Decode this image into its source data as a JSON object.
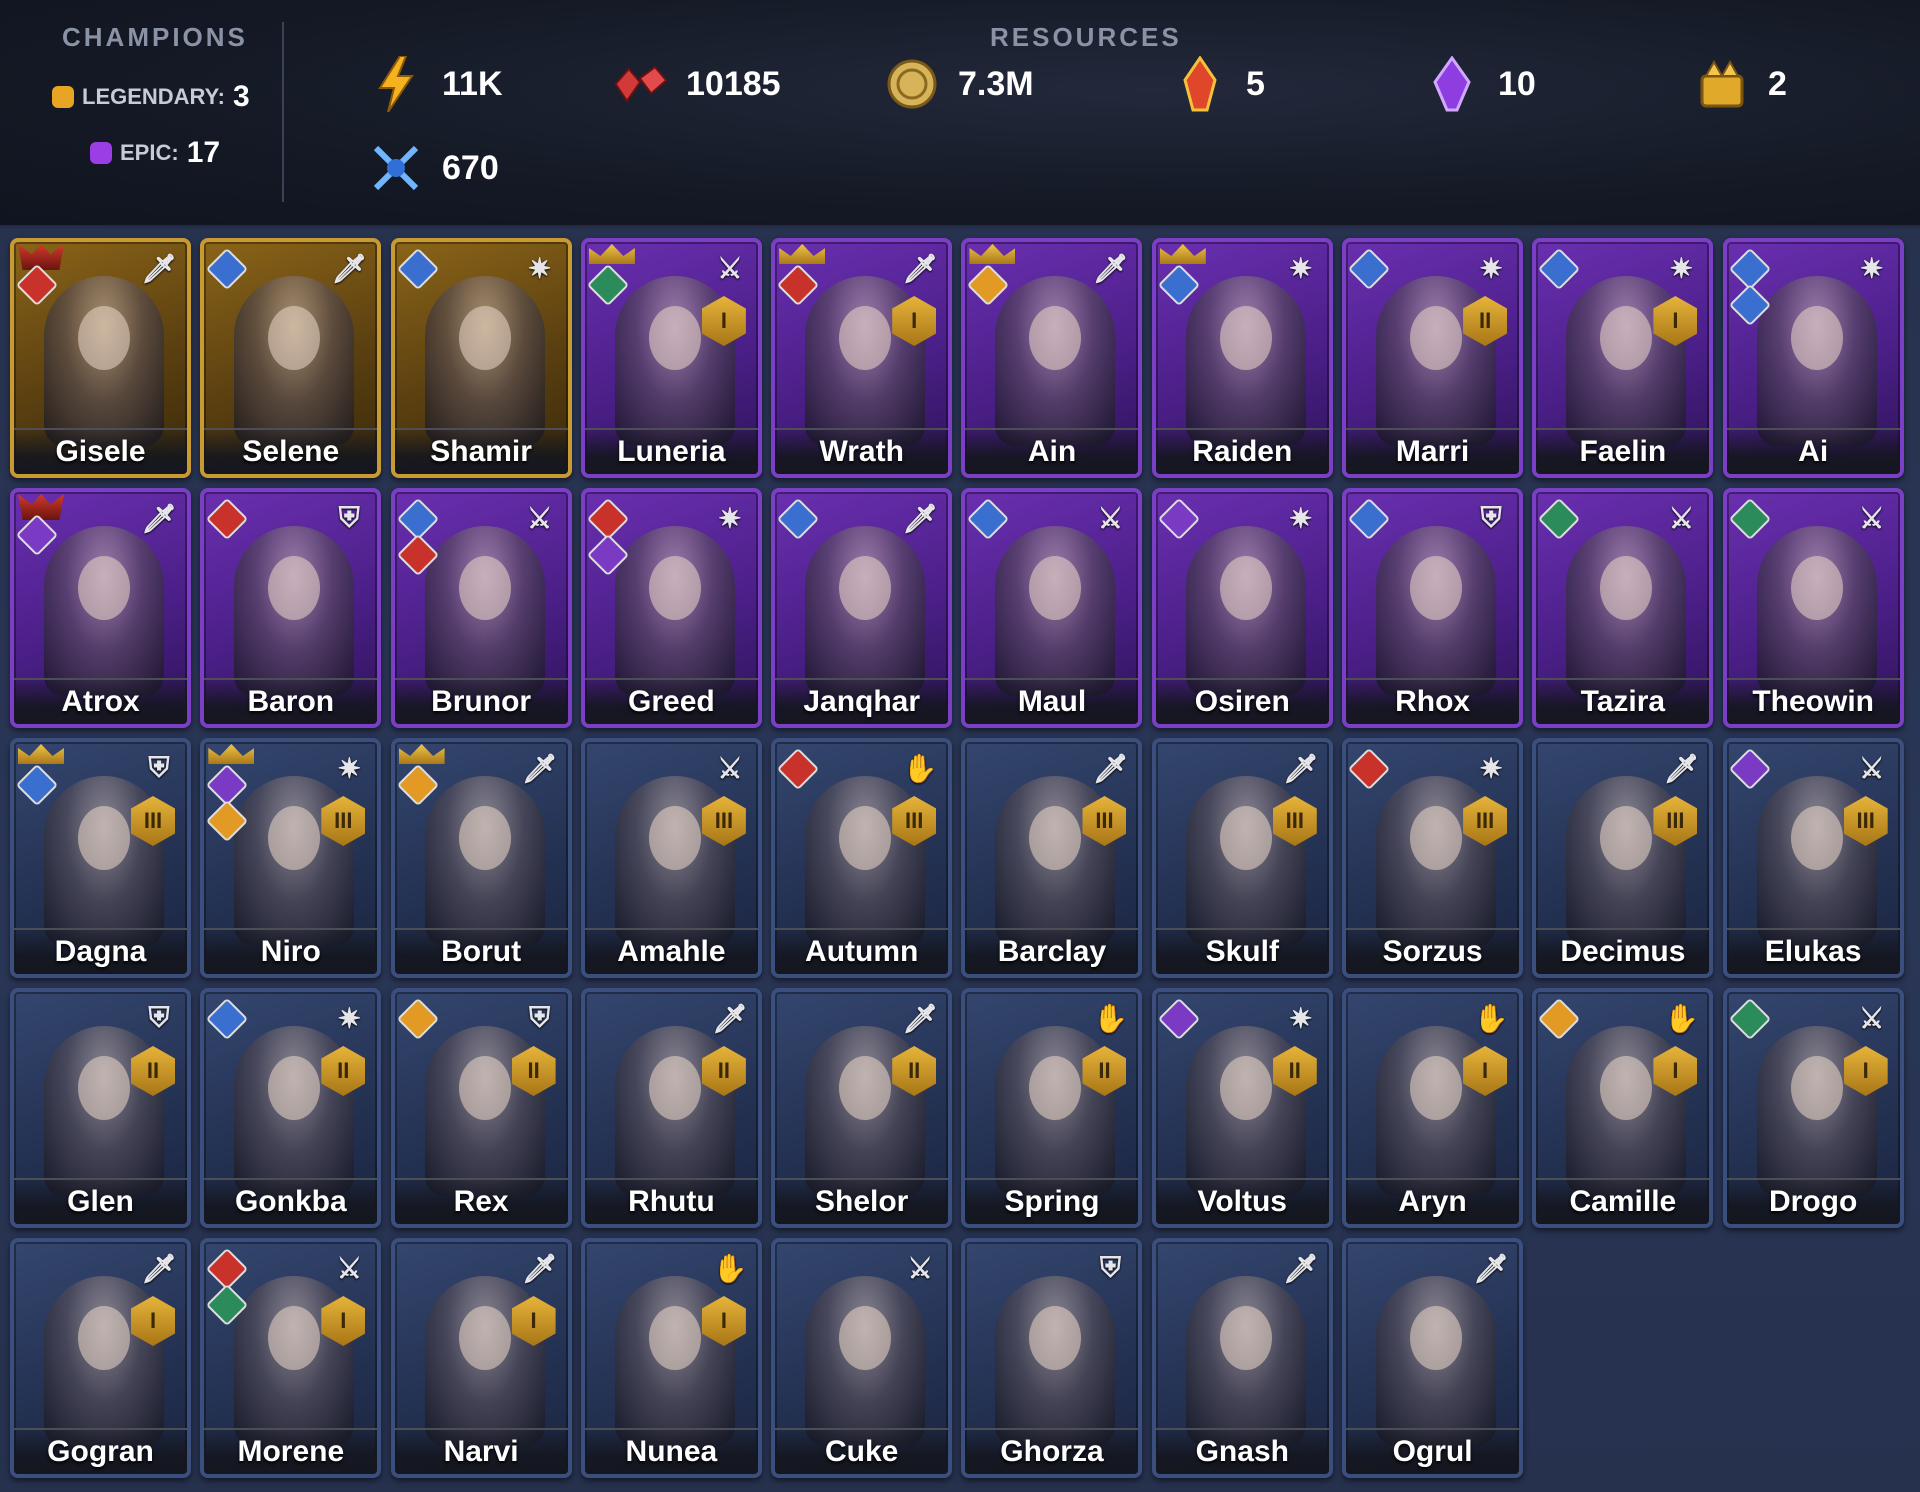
{
  "header": {
    "champions_title": "CHAMPIONS",
    "resources_title": "RESOURCES",
    "legendary": {
      "label": "LEGENDARY:",
      "count": "3",
      "color": "#e8a523"
    },
    "epic": {
      "label": "EPIC:",
      "count": "17",
      "color": "#9c3ee6"
    },
    "resources": [
      {
        "icon": "energy-icon",
        "value": "11K"
      },
      {
        "icon": "ruby-gems-icon",
        "value": "10185"
      },
      {
        "icon": "silver-coin-icon",
        "value": "7.3M"
      },
      {
        "icon": "fire-crystal-icon",
        "value": "5"
      },
      {
        "icon": "void-crystal-icon",
        "value": "10"
      },
      {
        "icon": "gold-treasure-icon",
        "value": "2"
      },
      {
        "icon": "arena-tokens-icon",
        "value": "670"
      }
    ]
  },
  "champions": [
    {
      "name": "Gisele",
      "rarity": "legendary",
      "role": "dagger",
      "affinities": [
        "force"
      ],
      "tag": "skull"
    },
    {
      "name": "Selene",
      "rarity": "legendary",
      "role": "dagger",
      "affinities": [
        "magic"
      ]
    },
    {
      "name": "Shamir",
      "rarity": "legendary",
      "role": "staff",
      "affinities": [
        "magic"
      ]
    },
    {
      "name": "Luneria",
      "rarity": "epic",
      "role": "axes",
      "affinities": [
        "spirit"
      ],
      "tag": "crown",
      "rank": "I"
    },
    {
      "name": "Wrath",
      "rarity": "epic",
      "role": "dagger",
      "affinities": [
        "force"
      ],
      "tag": "crown",
      "rank": "I"
    },
    {
      "name": "Ain",
      "rarity": "epic",
      "role": "dagger",
      "affinities": [
        "gold"
      ],
      "tag": "crown"
    },
    {
      "name": "Raiden",
      "rarity": "epic",
      "role": "staff",
      "affinities": [
        "magic"
      ],
      "tag": "crown"
    },
    {
      "name": "Marri",
      "rarity": "epic",
      "role": "staff",
      "affinities": [
        "magic"
      ],
      "rank": "II"
    },
    {
      "name": "Faelin",
      "rarity": "epic",
      "role": "staff",
      "affinities": [
        "magic"
      ],
      "rank": "I"
    },
    {
      "name": "Ai",
      "rarity": "epic",
      "role": "staff",
      "affinities": [
        "magic",
        "magic"
      ]
    },
    {
      "name": "Atrox",
      "rarity": "epic",
      "role": "dagger",
      "affinities": [
        "void"
      ],
      "tag": "skull"
    },
    {
      "name": "Baron",
      "rarity": "epic",
      "role": "shield",
      "affinities": [
        "force"
      ]
    },
    {
      "name": "Brunor",
      "rarity": "epic",
      "role": "axes",
      "affinities": [
        "magic",
        "force"
      ]
    },
    {
      "name": "Greed",
      "rarity": "epic",
      "role": "staff",
      "affinities": [
        "force",
        "void"
      ]
    },
    {
      "name": "Janqhar",
      "rarity": "epic",
      "role": "dagger",
      "affinities": [
        "magic"
      ]
    },
    {
      "name": "Maul",
      "rarity": "epic",
      "role": "axes",
      "affinities": [
        "magic"
      ]
    },
    {
      "name": "Osiren",
      "rarity": "epic",
      "role": "staff",
      "affinities": [
        "void"
      ]
    },
    {
      "name": "Rhox",
      "rarity": "epic",
      "role": "shield",
      "affinities": [
        "magic"
      ]
    },
    {
      "name": "Tazira",
      "rarity": "epic",
      "role": "axes",
      "affinities": [
        "spirit"
      ]
    },
    {
      "name": "Theowin",
      "rarity": "epic",
      "role": "axes",
      "affinities": [
        "spirit"
      ]
    },
    {
      "name": "Dagna",
      "rarity": "rare",
      "role": "shield",
      "affinities": [
        "magic"
      ],
      "tag": "crown",
      "rank": "III"
    },
    {
      "name": "Niro",
      "rarity": "rare",
      "role": "staff",
      "affinities": [
        "void",
        "gold"
      ],
      "tag": "crown",
      "rank": "III"
    },
    {
      "name": "Borut",
      "rarity": "rare",
      "role": "dagger",
      "affinities": [
        "gold"
      ],
      "tag": "crown"
    },
    {
      "name": "Amahle",
      "rarity": "rare",
      "role": "axes",
      "affinities": [],
      "rank": "III"
    },
    {
      "name": "Autumn",
      "rarity": "rare",
      "role": "hands",
      "affinities": [
        "force"
      ],
      "rank": "III"
    },
    {
      "name": "Barclay",
      "rarity": "rare",
      "role": "dagger",
      "affinities": [],
      "rank": "III"
    },
    {
      "name": "Skulf",
      "rarity": "rare",
      "role": "dagger",
      "affinities": [],
      "rank": "III"
    },
    {
      "name": "Sorzus",
      "rarity": "rare",
      "role": "staff",
      "affinities": [
        "force"
      ],
      "rank": "III"
    },
    {
      "name": "Decimus",
      "rarity": "rare",
      "role": "dagger",
      "affinities": [],
      "rank": "III"
    },
    {
      "name": "Elukas",
      "rarity": "rare",
      "role": "axes",
      "affinities": [
        "void"
      ],
      "rank": "III"
    },
    {
      "name": "Glen",
      "rarity": "rare",
      "role": "shield",
      "affinities": [],
      "rank": "II"
    },
    {
      "name": "Gonkba",
      "rarity": "rare",
      "role": "staff",
      "affinities": [
        "magic"
      ],
      "rank": "II"
    },
    {
      "name": "Rex",
      "rarity": "rare",
      "role": "shield",
      "affinities": [
        "gold"
      ],
      "rank": "II"
    },
    {
      "name": "Rhutu",
      "rarity": "rare",
      "role": "dagger",
      "affinities": [],
      "rank": "II"
    },
    {
      "name": "Shelor",
      "rarity": "rare",
      "role": "dagger",
      "affinities": [],
      "rank": "II"
    },
    {
      "name": "Spring",
      "rarity": "rare",
      "role": "hands",
      "affinities": [],
      "rank": "II"
    },
    {
      "name": "Voltus",
      "rarity": "rare",
      "role": "staff",
      "affinities": [
        "void"
      ],
      "rank": "II"
    },
    {
      "name": "Aryn",
      "rarity": "rare",
      "role": "hands",
      "affinities": [],
      "rank": "I"
    },
    {
      "name": "Camille",
      "rarity": "rare",
      "role": "hands",
      "affinities": [
        "gold"
      ],
      "rank": "I"
    },
    {
      "name": "Drogo",
      "rarity": "rare",
      "role": "axes",
      "affinities": [
        "spirit"
      ],
      "rank": "I"
    },
    {
      "name": "Gogran",
      "rarity": "rare",
      "role": "dagger",
      "affinities": [],
      "rank": "I"
    },
    {
      "name": "Morene",
      "rarity": "rare",
      "role": "axes",
      "affinities": [
        "force",
        "spirit"
      ],
      "rank": "I"
    },
    {
      "name": "Narvi",
      "rarity": "rare",
      "role": "dagger",
      "affinities": [],
      "rank": "I"
    },
    {
      "name": "Nunea",
      "rarity": "rare",
      "role": "hands",
      "affinities": [],
      "rank": "I"
    },
    {
      "name": "Cuke",
      "rarity": "rare",
      "role": "axes",
      "affinities": []
    },
    {
      "name": "Ghorza",
      "rarity": "rare",
      "role": "shield",
      "affinities": []
    },
    {
      "name": "Gnash",
      "rarity": "rare",
      "role": "dagger",
      "affinities": []
    },
    {
      "name": "Ogrul",
      "rarity": "rare",
      "role": "dagger",
      "affinities": []
    }
  ]
}
